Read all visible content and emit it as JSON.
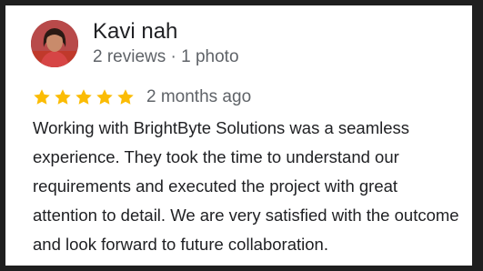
{
  "review": {
    "author_name": "Kavi nah",
    "author_meta": "2 reviews · 1 photo",
    "rating": 5,
    "rating_max": 5,
    "time_ago": "2 months ago",
    "text": "Working with BrightByte Solutions was a seamless experience. They took the time to understand our requirements and executed the project with great attention to detail. We are very satisfied with the outcome and look forward to future collaboration."
  },
  "colors": {
    "star": "#fbbc04",
    "text_primary": "#202124",
    "text_secondary": "#5f6368"
  },
  "icons": {
    "avatar": "user-photo-avatar",
    "star": "star-icon"
  }
}
